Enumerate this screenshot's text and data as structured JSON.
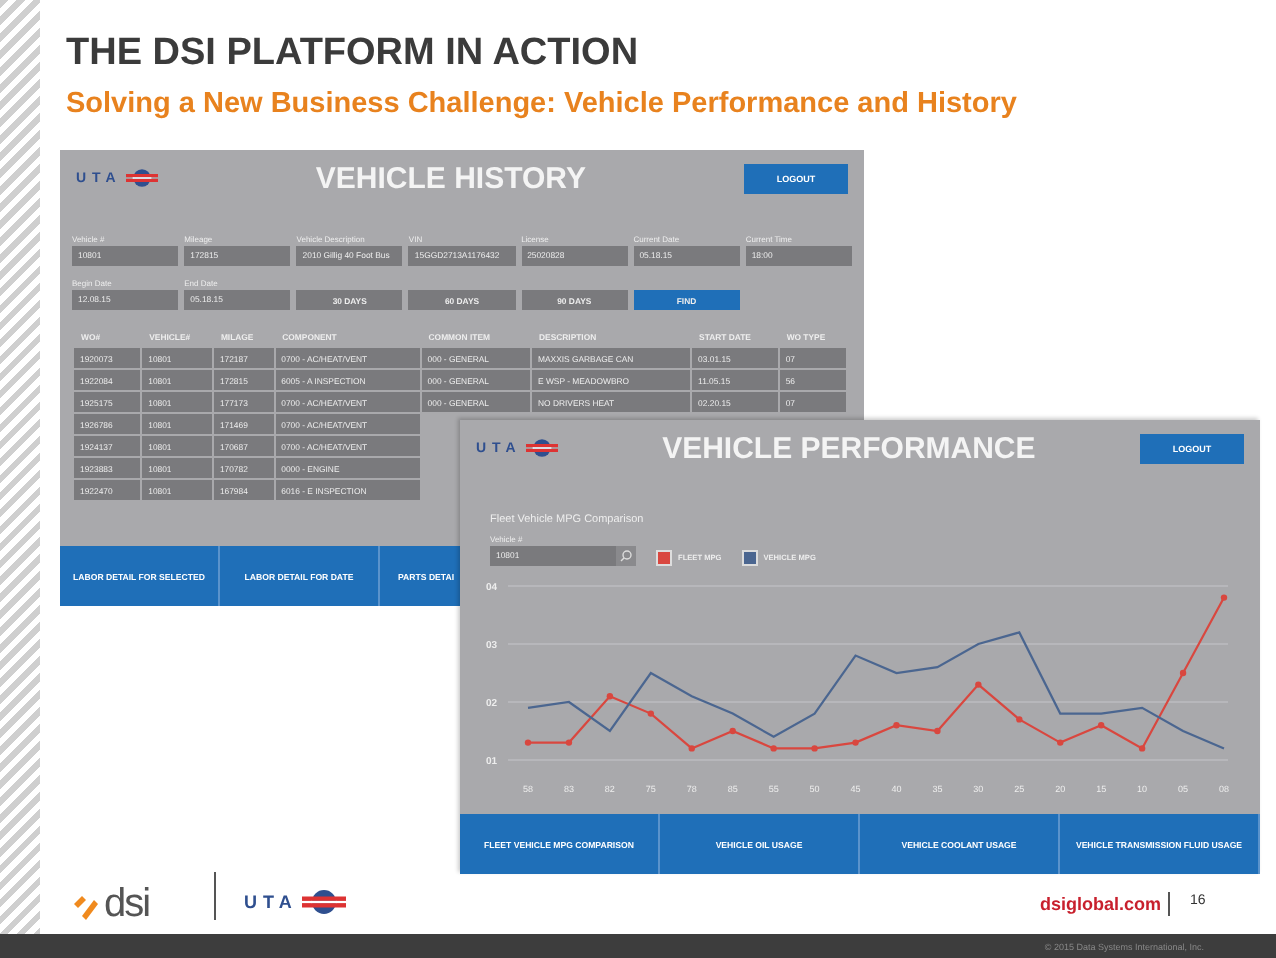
{
  "slide": {
    "title": "THE DSI PLATFORM IN ACTION",
    "subtitle": "Solving a New Business Challenge: Vehicle Performance and History"
  },
  "history_window": {
    "logo": "UTA",
    "title": "VEHICLE HISTORY",
    "logout": "LOGOUT",
    "fields": [
      {
        "label": "Vehicle #",
        "value": "10801"
      },
      {
        "label": "Mileage",
        "value": "172815"
      },
      {
        "label": "Vehicle Description",
        "value": "2010 Gillig 40 Foot Bus"
      },
      {
        "label": "VIN",
        "value": "15GGD2713A1176432"
      },
      {
        "label": "License",
        "value": "25020828"
      },
      {
        "label": "Current Date",
        "value": "05.18.15"
      },
      {
        "label": "Current Time",
        "value": "18:00"
      }
    ],
    "date_fields": [
      {
        "label": "Begin Date",
        "value": "12.08.15"
      },
      {
        "label": "End Date",
        "value": "05.18.15"
      }
    ],
    "range_buttons": [
      "30 DAYS",
      "60 DAYS",
      "90 DAYS"
    ],
    "find": "FIND",
    "table": {
      "columns": [
        "WO#",
        "VEHICLE#",
        "MILAGE",
        "COMPONENT",
        "COMMON ITEM",
        "DESCRIPTION",
        "START DATE",
        "WO TYPE"
      ],
      "rows": [
        [
          "1920073",
          "10801",
          "172187",
          "0700 - AC/HEAT/VENT",
          "000 - GENERAL",
          "MAXXIS GARBAGE CAN",
          "03.01.15",
          "07"
        ],
        [
          "1922084",
          "10801",
          "172815",
          "6005 - A INSPECTION",
          "000 - GENERAL",
          "E WSP - MEADOWBRO",
          "11.05.15",
          "56"
        ],
        [
          "1925175",
          "10801",
          "177173",
          "0700 - AC/HEAT/VENT",
          "000 - GENERAL",
          "NO DRIVERS HEAT",
          "02.20.15",
          "07"
        ],
        [
          "1926786",
          "10801",
          "171469",
          "0700 - AC/HEAT/VENT"
        ],
        [
          "1924137",
          "10801",
          "170687",
          "0700 - AC/HEAT/VENT"
        ],
        [
          "1923883",
          "10801",
          "170782",
          "0000 - ENGINE"
        ],
        [
          "1922470",
          "10801",
          "167984",
          "6016 - E INSPECTION"
        ]
      ]
    },
    "actions": [
      "LABOR DETAIL FOR SELECTED",
      "LABOR DETAIL FOR DATE",
      "PARTS DETAI"
    ]
  },
  "performance_window": {
    "logo": "UTA",
    "title": "VEHICLE PERFORMANCE",
    "logout": "LOGOUT",
    "section": "Fleet Vehicle MPG Comparison",
    "vehicle_field": {
      "label": "Vehicle #",
      "value": "10801"
    },
    "filters": [
      {
        "checked": true
      },
      {
        "checked": true
      }
    ],
    "chart_data": {
      "type": "line",
      "categories": [
        "58",
        "83",
        "82",
        "75",
        "78",
        "85",
        "55",
        "50",
        "45",
        "40",
        "35",
        "30",
        "25",
        "20",
        "15",
        "10",
        "05",
        "08"
      ],
      "yticks": [
        {
          "value": 4,
          "label": "04"
        },
        {
          "value": 3,
          "label": "03"
        },
        {
          "value": 2,
          "label": "02"
        },
        {
          "value": 1,
          "label": "01"
        }
      ],
      "ylim": [
        1,
        4
      ],
      "grid": true,
      "series": [
        {
          "name": "FLEET MPG",
          "color": "#d9473f",
          "marker": "circle",
          "values": [
            1.3,
            1.3,
            2.1,
            1.8,
            1.2,
            1.5,
            1.2,
            1.2,
            1.3,
            1.6,
            1.5,
            2.3,
            1.7,
            1.3,
            1.6,
            1.2,
            2.5,
            3.8
          ]
        },
        {
          "name": "VEHICLE MPG",
          "color": "#4b6690",
          "values": [
            1.9,
            2,
            1.5,
            2.5,
            2.1,
            1.8,
            1.4,
            1.8,
            2.8,
            2.5,
            2.6,
            3,
            3.2,
            1.8,
            1.8,
            1.9,
            1.5,
            1.2
          ]
        }
      ]
    },
    "actions": [
      "FLEET VEHICLE MPG COMPARISON",
      "VEHICLE OIL USAGE",
      "VEHICLE COOLANT USAGE",
      "VEHICLE TRANSMISSION FLUID USAGE"
    ]
  },
  "footer": {
    "logo": "dsi",
    "partner_logo": "UTA",
    "website": "dsiglobal.com",
    "page": "16",
    "copyright": "© 2015 Data Systems International, Inc."
  }
}
